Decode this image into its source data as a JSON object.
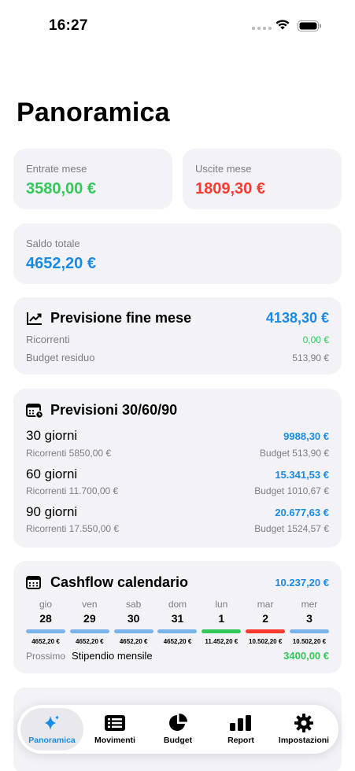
{
  "status_bar": {
    "time": "16:27"
  },
  "page_title": "Panoramica",
  "colors": {
    "accent": "#1a8be5",
    "positive": "#34c759",
    "negative": "#ff3b30",
    "card_bg": "#f2f2f7"
  },
  "summary": {
    "income": {
      "label": "Entrate mese",
      "value": "3580,00 €"
    },
    "expenses": {
      "label": "Uscite mese",
      "value": "1809,30 €"
    },
    "balance": {
      "label": "Saldo totale",
      "value": "4652,20 €"
    }
  },
  "month_end_forecast": {
    "icon": "chart-line-uptrend-icon",
    "title": "Previsione fine mese",
    "value": "4138,30 €",
    "rows": [
      {
        "label": "Ricorrenti",
        "value": "0,00 €"
      },
      {
        "label": "Budget residuo",
        "value": "513,90 €"
      }
    ]
  },
  "forecasts": {
    "icon": "calendar-badge-icon",
    "title": "Previsioni 30/60/90",
    "items": [
      {
        "period": "30 giorni",
        "value": "9988,30 €",
        "recurring": "Ricorrenti 5850,00 €",
        "budget": "Budget 513,90 €"
      },
      {
        "period": "60 giorni",
        "value": "15.341,53 €",
        "recurring": "Ricorrenti 11.700,00 €",
        "budget": "Budget 1010,67 €"
      },
      {
        "period": "90 giorni",
        "value": "20.677,63 €",
        "recurring": "Ricorrenti 17.550,00 €",
        "budget": "Budget 1524,57 €"
      }
    ]
  },
  "cashflow": {
    "icon": "calendar-icon",
    "title": "Cashflow calendario",
    "value": "10.237,20 €",
    "days": [
      {
        "weekday": "gio",
        "day": "28",
        "amount": "4652,20 €",
        "bar_color": "#79b3ea"
      },
      {
        "weekday": "ven",
        "day": "29",
        "amount": "4652,20 €",
        "bar_color": "#79b3ea"
      },
      {
        "weekday": "sab",
        "day": "30",
        "amount": "4652,20 €",
        "bar_color": "#79b3ea"
      },
      {
        "weekday": "dom",
        "day": "31",
        "amount": "4652,20 €",
        "bar_color": "#79b3ea"
      },
      {
        "weekday": "lun",
        "day": "1",
        "amount": "11.452,20 €",
        "bar_color": "#34c759"
      },
      {
        "weekday": "mar",
        "day": "2",
        "amount": "10.502,20 €",
        "bar_color": "#ff3b30"
      },
      {
        "weekday": "mer",
        "day": "3",
        "amount": "10.502,20 €",
        "bar_color": "#79b3ea"
      }
    ],
    "next": {
      "label": "Prossimo",
      "title": "Stipendio mensile",
      "value": "3400,00 €"
    }
  },
  "tabbar": {
    "tabs": [
      {
        "label": "Panoramica",
        "icon": "sparkles-icon",
        "active": true
      },
      {
        "label": "Movimenti",
        "icon": "list-icon",
        "active": false
      },
      {
        "label": "Budget",
        "icon": "pie-chart-icon",
        "active": false
      },
      {
        "label": "Report",
        "icon": "bar-chart-icon",
        "active": false
      },
      {
        "label": "Impostazioni",
        "icon": "gear-icon",
        "active": false
      }
    ]
  }
}
